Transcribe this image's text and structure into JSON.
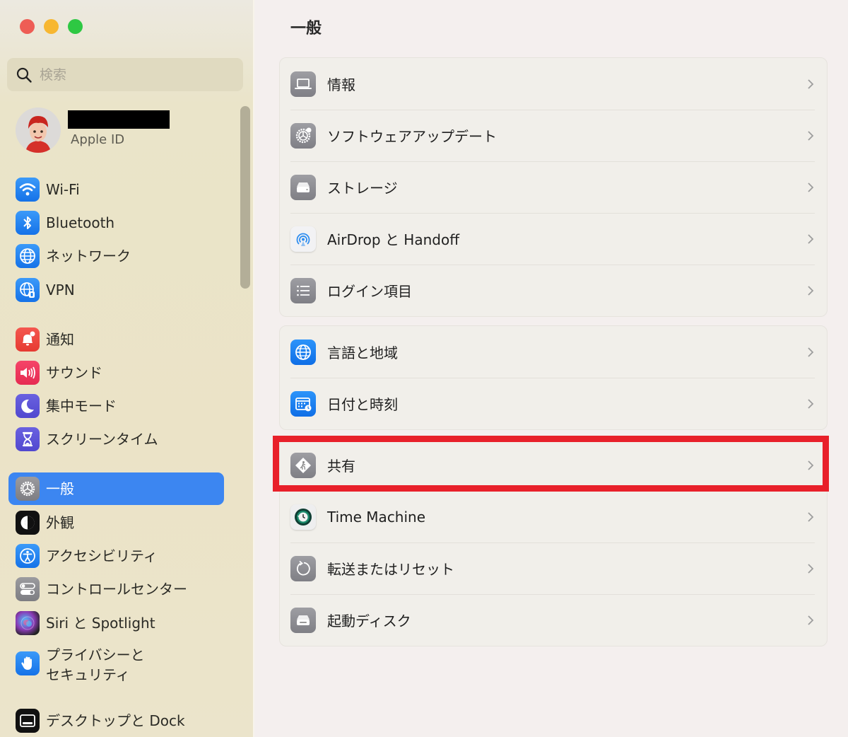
{
  "window": {
    "controls": [
      "close",
      "minimize",
      "maximize"
    ]
  },
  "sidebar": {
    "search": {
      "placeholder": "検索",
      "value": ""
    },
    "profile": {
      "name": "",
      "subtitle": "Apple ID"
    },
    "items": [
      {
        "label": "Wi-Fi",
        "icon": "wifi-icon",
        "color": "#1a7df0"
      },
      {
        "label": "Bluetooth",
        "icon": "bluetooth-icon",
        "color": "#1a7df0"
      },
      {
        "label": "ネットワーク",
        "icon": "globe-icon",
        "color": "#1a7df0"
      },
      {
        "label": "VPN",
        "icon": "vpn-globe-icon",
        "color": "#1a7df0"
      },
      {
        "label": "通知",
        "icon": "bell-icon",
        "color": "#ea4039"
      },
      {
        "label": "サウンド",
        "icon": "speaker-icon",
        "color": "#eb3158"
      },
      {
        "label": "集中モード",
        "icon": "moon-icon",
        "color": "#5b52d6"
      },
      {
        "label": "スクリーンタイム",
        "icon": "hourglass-icon",
        "color": "#5b52d6"
      },
      {
        "label": "一般",
        "icon": "gear-icon",
        "color": "#8a8a8f",
        "selected": true
      },
      {
        "label": "外観",
        "icon": "appearance-icon",
        "color": "#111111"
      },
      {
        "label": "アクセシビリティ",
        "icon": "accessibility-icon",
        "color": "#1a7df0"
      },
      {
        "label": "コントロールセンター",
        "icon": "toggles-icon",
        "color": "#8a8a8f"
      },
      {
        "label": "Siri と Spotlight",
        "icon": "siri-icon",
        "color": "#6b3aa5"
      },
      {
        "label": "プライバシーと\nセキュリティ",
        "line1": "プライバシーと",
        "line2": "セキュリティ",
        "icon": "hand-icon",
        "color": "#1a7df0"
      },
      {
        "label": "デスクトップと Dock",
        "icon": "dock-icon",
        "color": "#111111"
      }
    ],
    "selected_color": "#3c86f1"
  },
  "main": {
    "title": "一般",
    "groups": [
      {
        "rows": [
          {
            "label": "情報",
            "icon": "laptop-icon"
          },
          {
            "label": "ソフトウェアアップデート",
            "icon": "software-update-gear-icon"
          },
          {
            "label": "ストレージ",
            "icon": "storage-drive-icon"
          },
          {
            "label": "AirDrop と Handoff",
            "icon": "airdrop-icon"
          },
          {
            "label": "ログイン項目",
            "icon": "list-icon"
          }
        ]
      },
      {
        "rows": [
          {
            "label": "言語と地域",
            "icon": "globe-icon"
          },
          {
            "label": "日付と時刻",
            "icon": "calendar-clock-icon"
          }
        ]
      },
      {
        "rows": [
          {
            "label": "共有",
            "icon": "sharing-icon",
            "highlighted": true
          },
          {
            "label": "Time Machine",
            "icon": "time-machine-icon"
          },
          {
            "label": "転送またはリセット",
            "icon": "reset-icon"
          },
          {
            "label": "起動ディスク",
            "icon": "startup-disk-icon"
          }
        ]
      }
    ],
    "highlight_color": "#e8202a"
  }
}
